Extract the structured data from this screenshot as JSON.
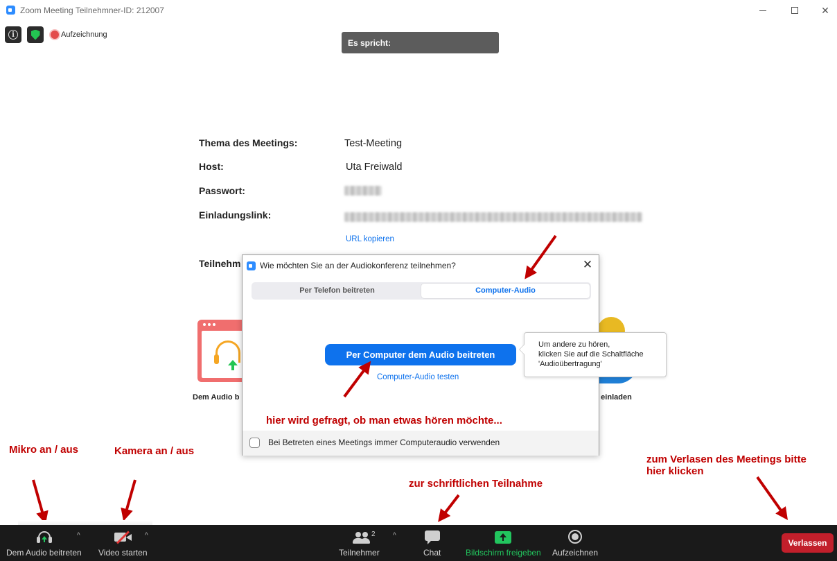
{
  "window": {
    "title": "Zoom Meeting Teilnehmner-ID: 212007",
    "recording_label": "Aufzeichnung"
  },
  "speaker": {
    "label": "Es spricht:"
  },
  "meeting_info": {
    "topic_label": "Thema des Meetings:",
    "topic_value": "Test-Meeting",
    "host_label": "Host:",
    "host_value": "Uta Freiwald",
    "password_label": "Passwort:",
    "invite_label": "Einladungslink:",
    "copy_url": "URL kopieren",
    "participant_label_partial": "Teilnehm"
  },
  "tiles": {
    "audio_label_partial": "Dem Audio b",
    "invite_label_partial": "e einladen"
  },
  "dialog": {
    "title": "Wie möchten Sie an der Audiokonferenz teilnehmen?",
    "tab_phone": "Per Telefon beitreten",
    "tab_computer": "Computer-Audio",
    "join_button": "Per Computer dem Audio beitreten",
    "test_link": "Computer-Audio testen",
    "checkbox_label": "Bei Betreten eines Meetings immer Computeraudio verwenden"
  },
  "tooltip": {
    "line1": "Um andere zu hören,",
    "line2": "klicken Sie auf die Schaltfläche",
    "line3": "'Audioübertragung'"
  },
  "annotations": {
    "question": "hier wird gefragt, ob man etwas hören möchte...",
    "mic": "Mikro an / aus",
    "camera": "Kamera an / aus",
    "chat": "zur schriftlichen Teilnahme",
    "leave_line1": "zum Verlasen des Meetings bitte",
    "leave_line2": "hier klicken"
  },
  "toolbar": {
    "audio": "Dem Audio beitreten",
    "video": "Video starten",
    "participants": "Teilnehmer",
    "participants_count": "2",
    "chat": "Chat",
    "share": "Bildschirm freigeben",
    "record": "Aufzeichnen",
    "leave": "Verlassen"
  },
  "colors": {
    "accent": "#0e72ed",
    "annotation_red": "#c00000",
    "share_green": "#22c55e",
    "leave_red": "#c21f2b",
    "toolbar_bg": "#1a1a1a"
  }
}
